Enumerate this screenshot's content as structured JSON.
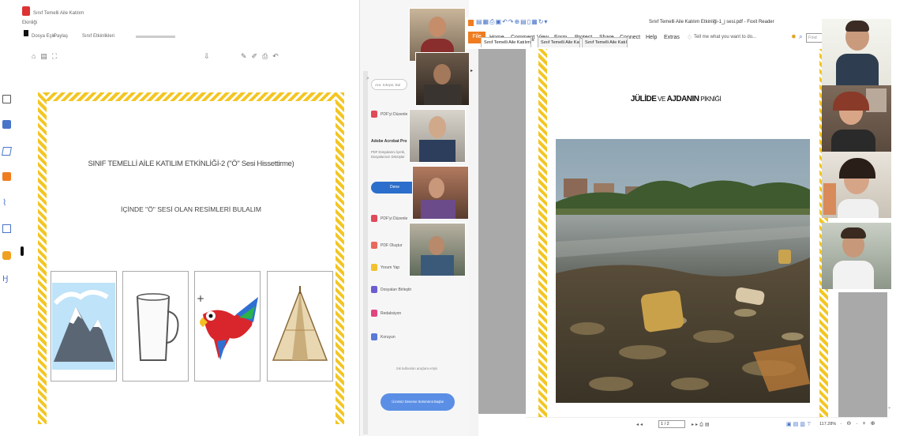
{
  "left_app": {
    "header_line1": "Sınıf Temelli Aile Katılım",
    "header_line2": "Ekinliği",
    "menu": [
      "Dosya Eşle",
      "Paylaş",
      "Sınıf Etkinlikleri"
    ],
    "worksheet_title": "SINIF TEMELLİ AİLE KATILIM ETKİNLİĞİ-2 (\"Ö\" Sesi Hissettirme)",
    "worksheet_subtitle": "İÇİNDE \"Ö\" SESİ OLAN RESİMLERİ BULALIM"
  },
  "middle_app": {
    "search_placeholder": "Ara: Sıkıştır, Bul",
    "section_title": "Adobe Acrobat Pro",
    "section_text": "PDF Dosyalarını İçerik, Dosyalarınızı Dönüştür",
    "button_label": "Dene",
    "items": [
      "PDF'yi Düzenle",
      "PDF Oluştur",
      "Yorum Yap",
      "Dosyaları Birleştir",
      "Redaksiyon",
      "Koruyun"
    ],
    "footer_text": "Sık kullanılan araçlara erişin",
    "footer_button": "Ücretsiz Deneme Sürümünü Başlat"
  },
  "foxit": {
    "window_title": "Sınıf Temelli Aile Katılım Etkinliği-1_j sesi.pdf - Foxit Reader",
    "menu": [
      "File",
      "Home",
      "Comment",
      "View",
      "Form",
      "Protect",
      "Share",
      "Connect",
      "Help",
      "Extras"
    ],
    "tell_me": "Tell me what you want to do...",
    "find_placeholder": "Find",
    "tabs": [
      "Sınıf Temelli Aile Katılım...",
      "Sınıf Temelli Aile Katılı...",
      "Sınıf Temelli Aile Katılı..."
    ],
    "page_heading_a": "JÜLİDE",
    "page_heading_b": " VE ",
    "page_heading_c": "AJDANIN",
    "page_heading_d": " PİKNİĞİ",
    "status_zoom": "117.28%",
    "status_page": "1 / 2"
  },
  "colors": {
    "foxit_orange": "#f07c20",
    "ribbon_yellow": "#f3c623",
    "acrobat_blue": "#2c6ecb"
  }
}
